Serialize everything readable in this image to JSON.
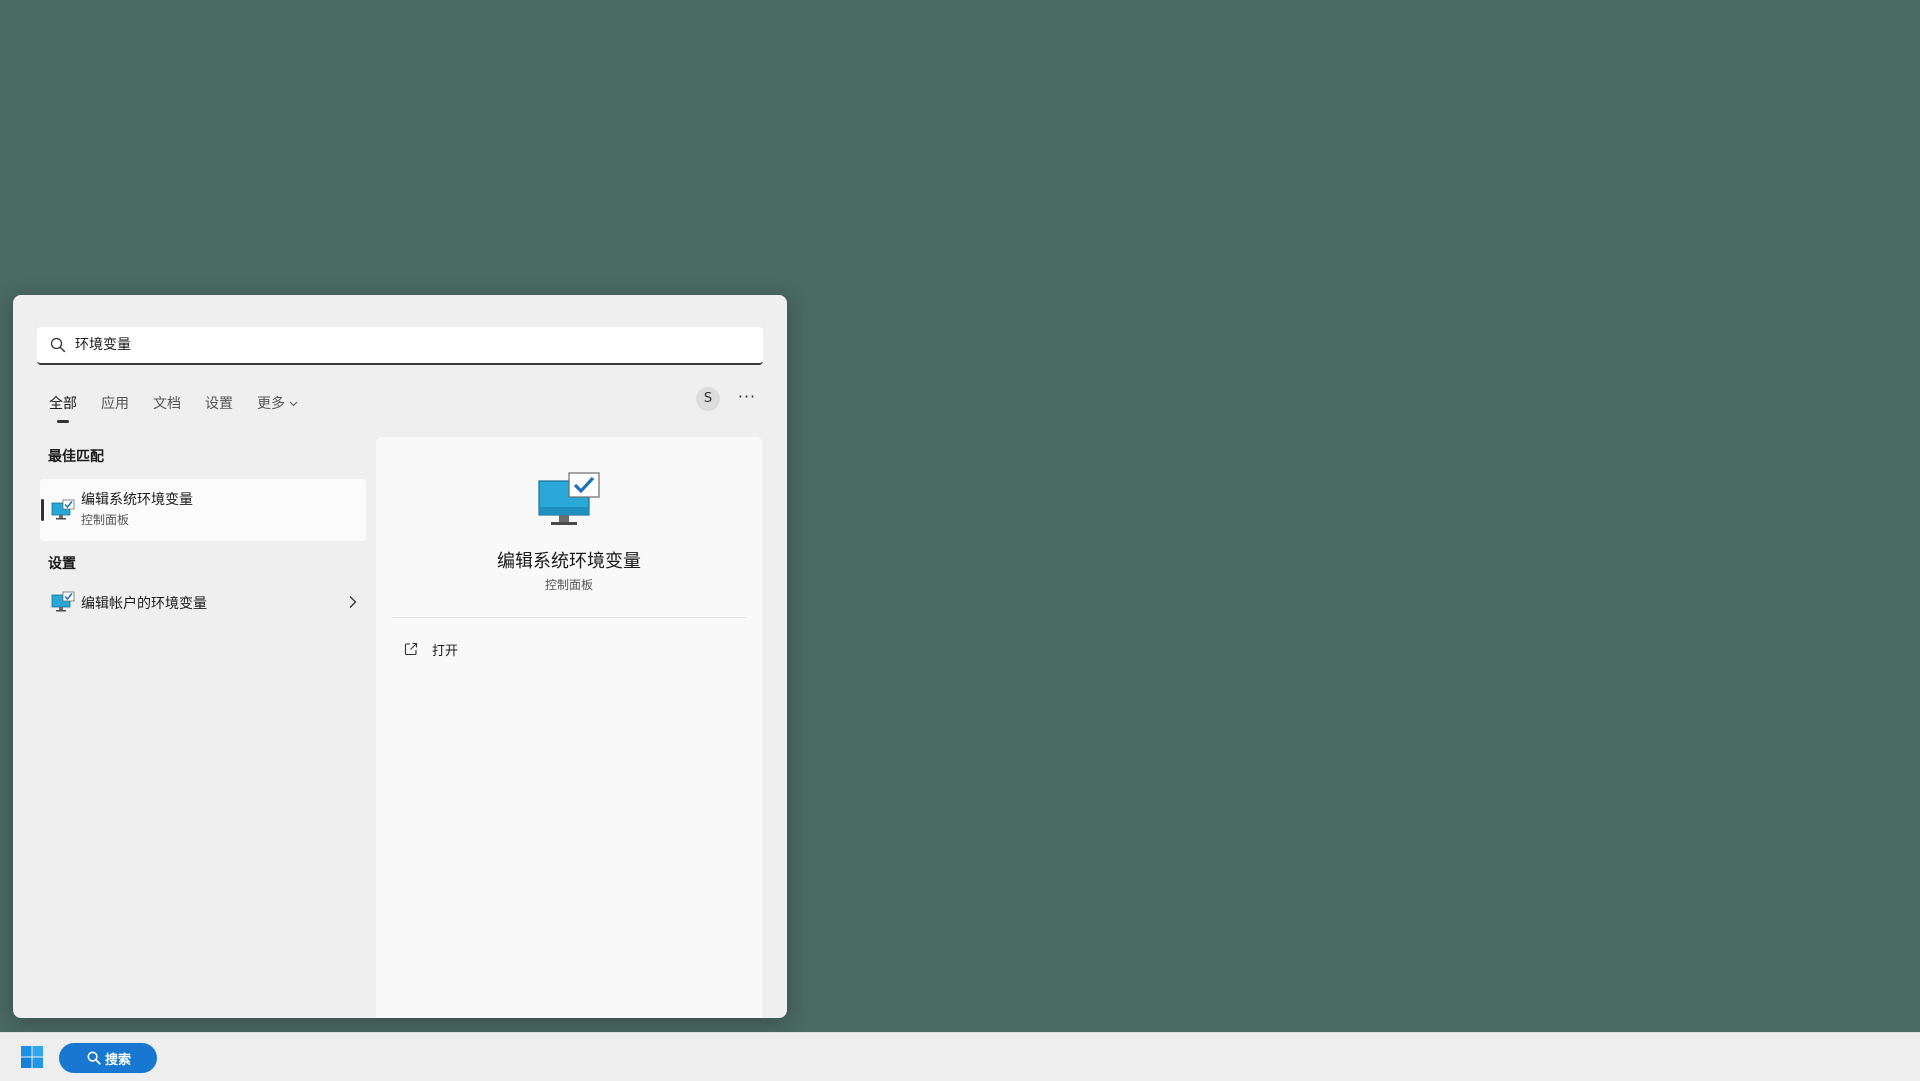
{
  "search": {
    "query": "环境变量"
  },
  "tabs": [
    {
      "label": "全部",
      "active": true
    },
    {
      "label": "应用",
      "active": false
    },
    {
      "label": "文档",
      "active": false
    },
    {
      "label": "设置",
      "active": false
    },
    {
      "label": "更多",
      "active": false
    }
  ],
  "header": {
    "avatar_initial": "S",
    "more_options": "···"
  },
  "best_match": {
    "section_title": "最佳匹配",
    "title": "编辑系统环境变量",
    "subtitle": "控制面板"
  },
  "settings_section": {
    "section_title": "设置",
    "item_title": "编辑帐户的环境变量"
  },
  "detail": {
    "title": "编辑系统环境变量",
    "subtitle": "控制面板",
    "open_label": "打开"
  },
  "taskbar": {
    "search_label": "搜索"
  },
  "colors": {
    "desktop": "#4a6961",
    "accent": "#1777d1",
    "panel": "#efefef"
  }
}
